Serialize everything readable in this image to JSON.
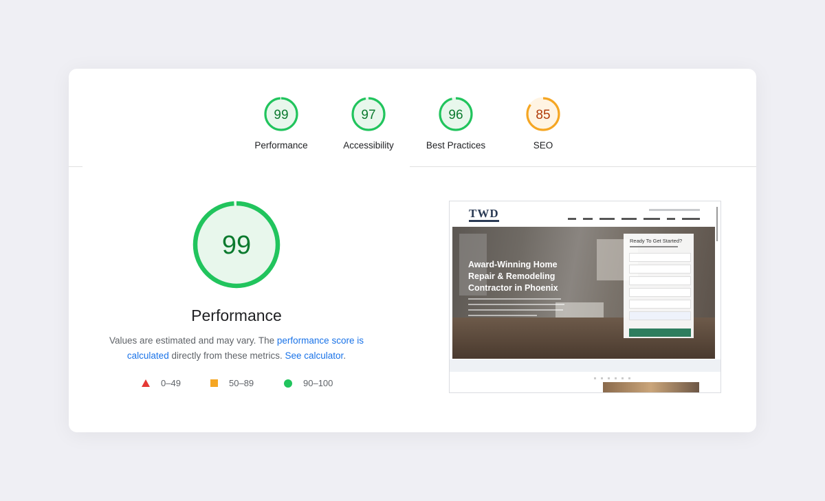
{
  "categories": [
    {
      "id": "performance",
      "label": "Performance",
      "score": 99,
      "status": "pass"
    },
    {
      "id": "accessibility",
      "label": "Accessibility",
      "score": 97,
      "status": "pass"
    },
    {
      "id": "best-practices",
      "label": "Best Practices",
      "score": 96,
      "status": "pass"
    },
    {
      "id": "seo",
      "label": "SEO",
      "score": 85,
      "status": "average"
    }
  ],
  "colors": {
    "pass": "#21c45d",
    "pass_text": "#0b7a2e",
    "pass_bg": "#e8f7ec",
    "average": "#f5a623",
    "average_text": "#b03a09",
    "average_bg": "#fff4e3",
    "fail": "#e53935",
    "link": "#1a73e8"
  },
  "detail": {
    "score": 99,
    "title": "Performance",
    "desc_prefix": "Values are estimated and may vary. The ",
    "link1": "performance score is calculated",
    "desc_middle": " directly from these metrics. ",
    "link2": "See calculator",
    "desc_suffix": "."
  },
  "legend": [
    {
      "shape": "triangle",
      "range": "0–49"
    },
    {
      "shape": "square",
      "range": "50–89"
    },
    {
      "shape": "circle",
      "range": "90–100"
    }
  ],
  "thumbnail": {
    "logo": "TWD",
    "hero_title": "Award-Winning Home Repair & Remodeling Contractor in Phoenix",
    "form_title": "Ready To Get Started?"
  }
}
